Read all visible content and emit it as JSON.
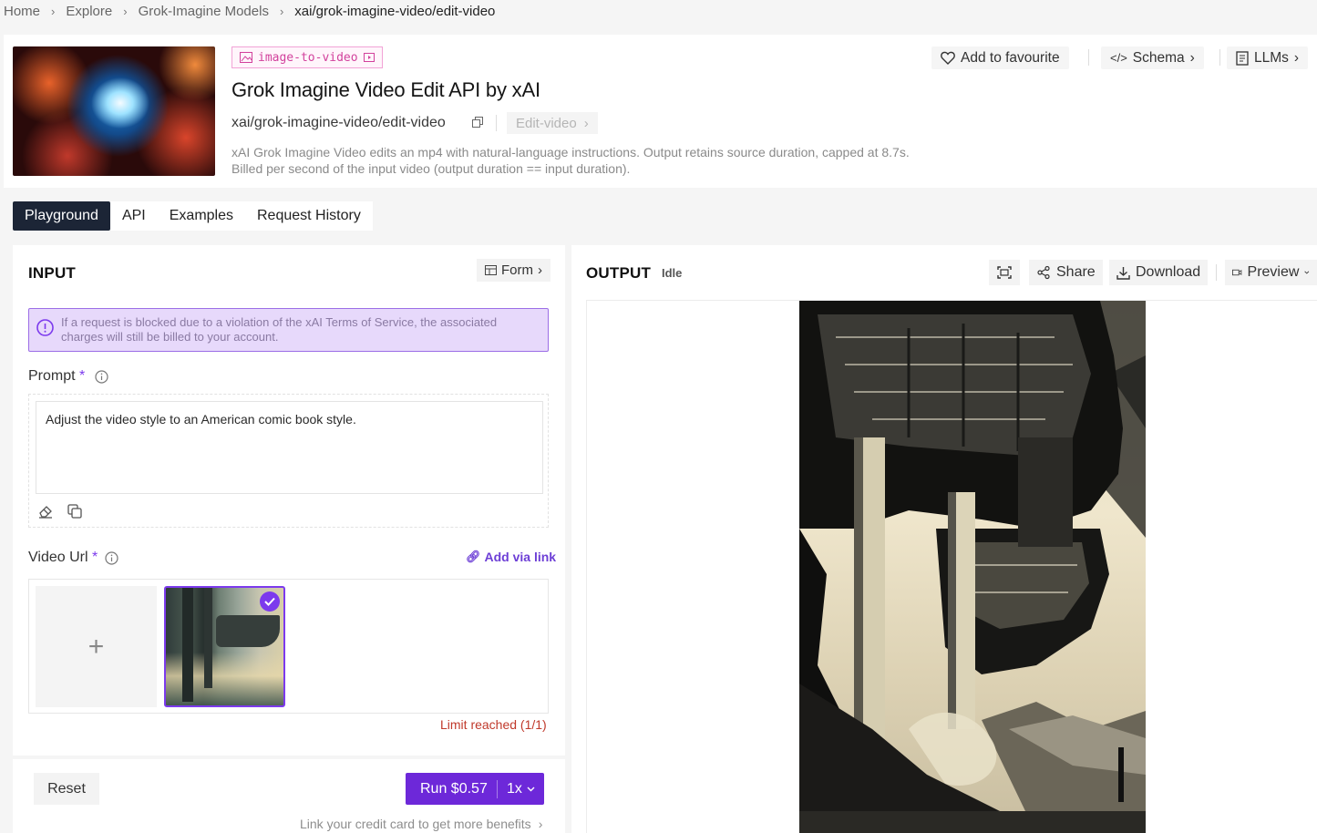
{
  "breadcrumb": {
    "items": [
      "Home",
      "Explore",
      "Grok-Imagine Models",
      "xai/grok-imagine-video/edit-video"
    ]
  },
  "header": {
    "tag": "image-to-video",
    "title": "Grok Imagine Video Edit API by xAI",
    "model_id": "xai/grok-imagine-video/edit-video",
    "variant_chip": "Edit-video",
    "description_line1": "xAI Grok Imagine Video edits an mp4 with natural-language instructions. Output retains source duration, capped at 8.7s.",
    "description_line2": "Billed per second of the input video (output duration == input duration).",
    "favourite_label": "Add to favourite",
    "schema_label": "Schema",
    "llms_label": "LLMs"
  },
  "tabs": [
    {
      "label": "Playground",
      "active": true
    },
    {
      "label": "API",
      "active": false
    },
    {
      "label": "Examples",
      "active": false
    },
    {
      "label": "Request History",
      "active": false
    }
  ],
  "input": {
    "title": "INPUT",
    "form_label": "Form",
    "alert_text": "If a request is blocked due to a violation of the xAI Terms of Service, the associated charges will still be billed to your account.",
    "prompt_label": "Prompt",
    "required_mark": "*",
    "prompt_value": "Adjust the video style to an American comic book style.",
    "video_url_label": "Video Url",
    "add_via_link": "Add via link",
    "upload_add_symbol": "+",
    "limit_text": "Limit reached (1/1)"
  },
  "actions": {
    "reset_label": "Reset",
    "run_label": "Run $0.57",
    "multiplier": "1x",
    "credit_link": "Link your credit card to get more benefits"
  },
  "output": {
    "title": "OUTPUT",
    "status": "Idle",
    "share_label": "Share",
    "download_label": "Download",
    "preview_label": "Preview"
  },
  "colors": {
    "accent": "#6d28d9",
    "tab_active": "#1c2536",
    "alert_bg": "#e7d9fb",
    "tag_pink": "#d2419c",
    "limit_red": "#c0392b"
  },
  "icons": {
    "favourite": "heart-icon",
    "schema": "code-icon",
    "llms": "document-icon",
    "form": "table-icon",
    "alert": "info-circle-icon",
    "clear": "eraser-icon",
    "copy": "copy-icon",
    "link": "link-icon",
    "fullscreen": "fullscreen-icon",
    "share": "share-icon",
    "download": "download-icon",
    "preview": "video-icon"
  }
}
